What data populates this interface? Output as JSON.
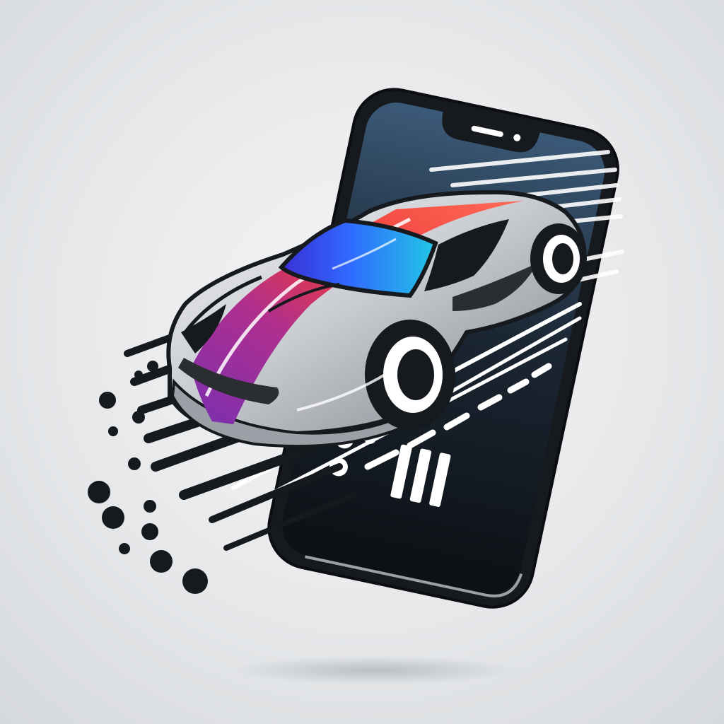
{
  "illustration": {
    "subject": "sports-car-bursting-from-smartphone",
    "icons": [
      "smartphone-icon",
      "sports-car-icon",
      "speed-lines-icon",
      "motion-dots-icon"
    ]
  },
  "colors": {
    "background": "#e6e8ea",
    "phone_body": "#16191d",
    "phone_screen_top": "#3b5a78",
    "phone_screen_bottom": "#0d1014",
    "car_silver": "#c9ccd1",
    "car_shadow": "#6b6f75",
    "stripe_purple": "#7a2fb0",
    "stripe_red": "#ee3b3b",
    "windshield_blue": "#2f6bff",
    "windshield_cyan": "#22c7e6",
    "accent_white": "#ffffff"
  }
}
